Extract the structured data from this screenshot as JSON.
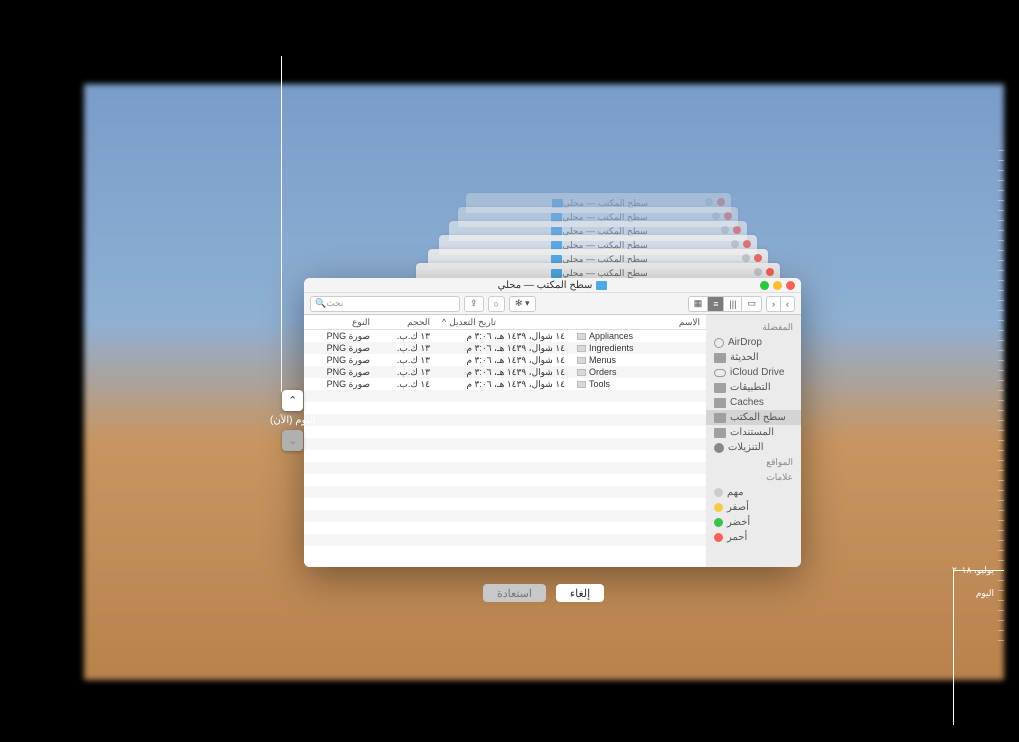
{
  "window": {
    "title": "سطح المكتب — محلي",
    "stacked_title": "سطح المكتب — محلي"
  },
  "toolbar": {
    "search_placeholder": "بحث"
  },
  "sidebar": {
    "favorites_header": "المفضلة",
    "items": [
      {
        "label": "AirDrop",
        "icon": "airdrop"
      },
      {
        "label": "الحديثة",
        "icon": "folder"
      },
      {
        "label": "iCloud Drive",
        "icon": "cloud"
      },
      {
        "label": "التطبيقات",
        "icon": "folder"
      },
      {
        "label": "Caches",
        "icon": "folder"
      },
      {
        "label": "سطح المكتب",
        "icon": "folder",
        "selected": true
      },
      {
        "label": "المستندات",
        "icon": "folder"
      },
      {
        "label": "التنزيلات",
        "icon": "download"
      }
    ],
    "locations_header": "المواقع",
    "tags_header": "علامات",
    "tags": [
      {
        "label": "مهم",
        "color": "#cccccc"
      },
      {
        "label": "أصفر",
        "color": "#f7c948"
      },
      {
        "label": "أخضر",
        "color": "#3cc24a"
      },
      {
        "label": "أحمر",
        "color": "#ff5f56"
      }
    ]
  },
  "columns": {
    "name": "الاسم",
    "date": "تاريخ التعديل",
    "size": "الحجم",
    "type": "النوع"
  },
  "files": [
    {
      "name": "Appliances",
      "date": "١٤ شوال، ١٤٣٩ هـ، ٣:٠٦ م",
      "size": "١٣ ك.ب.",
      "type": "صورة PNG"
    },
    {
      "name": "Ingredients",
      "date": "١٤ شوال، ١٤٣٩ هـ، ٣:٠٦ م",
      "size": "١٣ ك.ب.",
      "type": "صورة PNG"
    },
    {
      "name": "Menus",
      "date": "١٤ شوال، ١٤٣٩ هـ، ٣:٠٦ م",
      "size": "١٣ ك.ب.",
      "type": "صورة PNG"
    },
    {
      "name": "Orders",
      "date": "١٤ شوال، ١٤٣٩ هـ، ٣:٠٦ م",
      "size": "١٣ ك.ب.",
      "type": "صورة PNG"
    },
    {
      "name": "Tools",
      "date": "١٤ شوال، ١٤٣٩ هـ، ٣:٠٦ م",
      "size": "١٤ ك.ب.",
      "type": "صورة PNG"
    }
  ],
  "nav": {
    "current_label": "اليوم (الآن)"
  },
  "buttons": {
    "restore": "استعادة",
    "cancel": "إلغاء"
  },
  "timeline": {
    "top_label": "يوليو، ٢٠١٨",
    "today_label": "اليوم"
  }
}
